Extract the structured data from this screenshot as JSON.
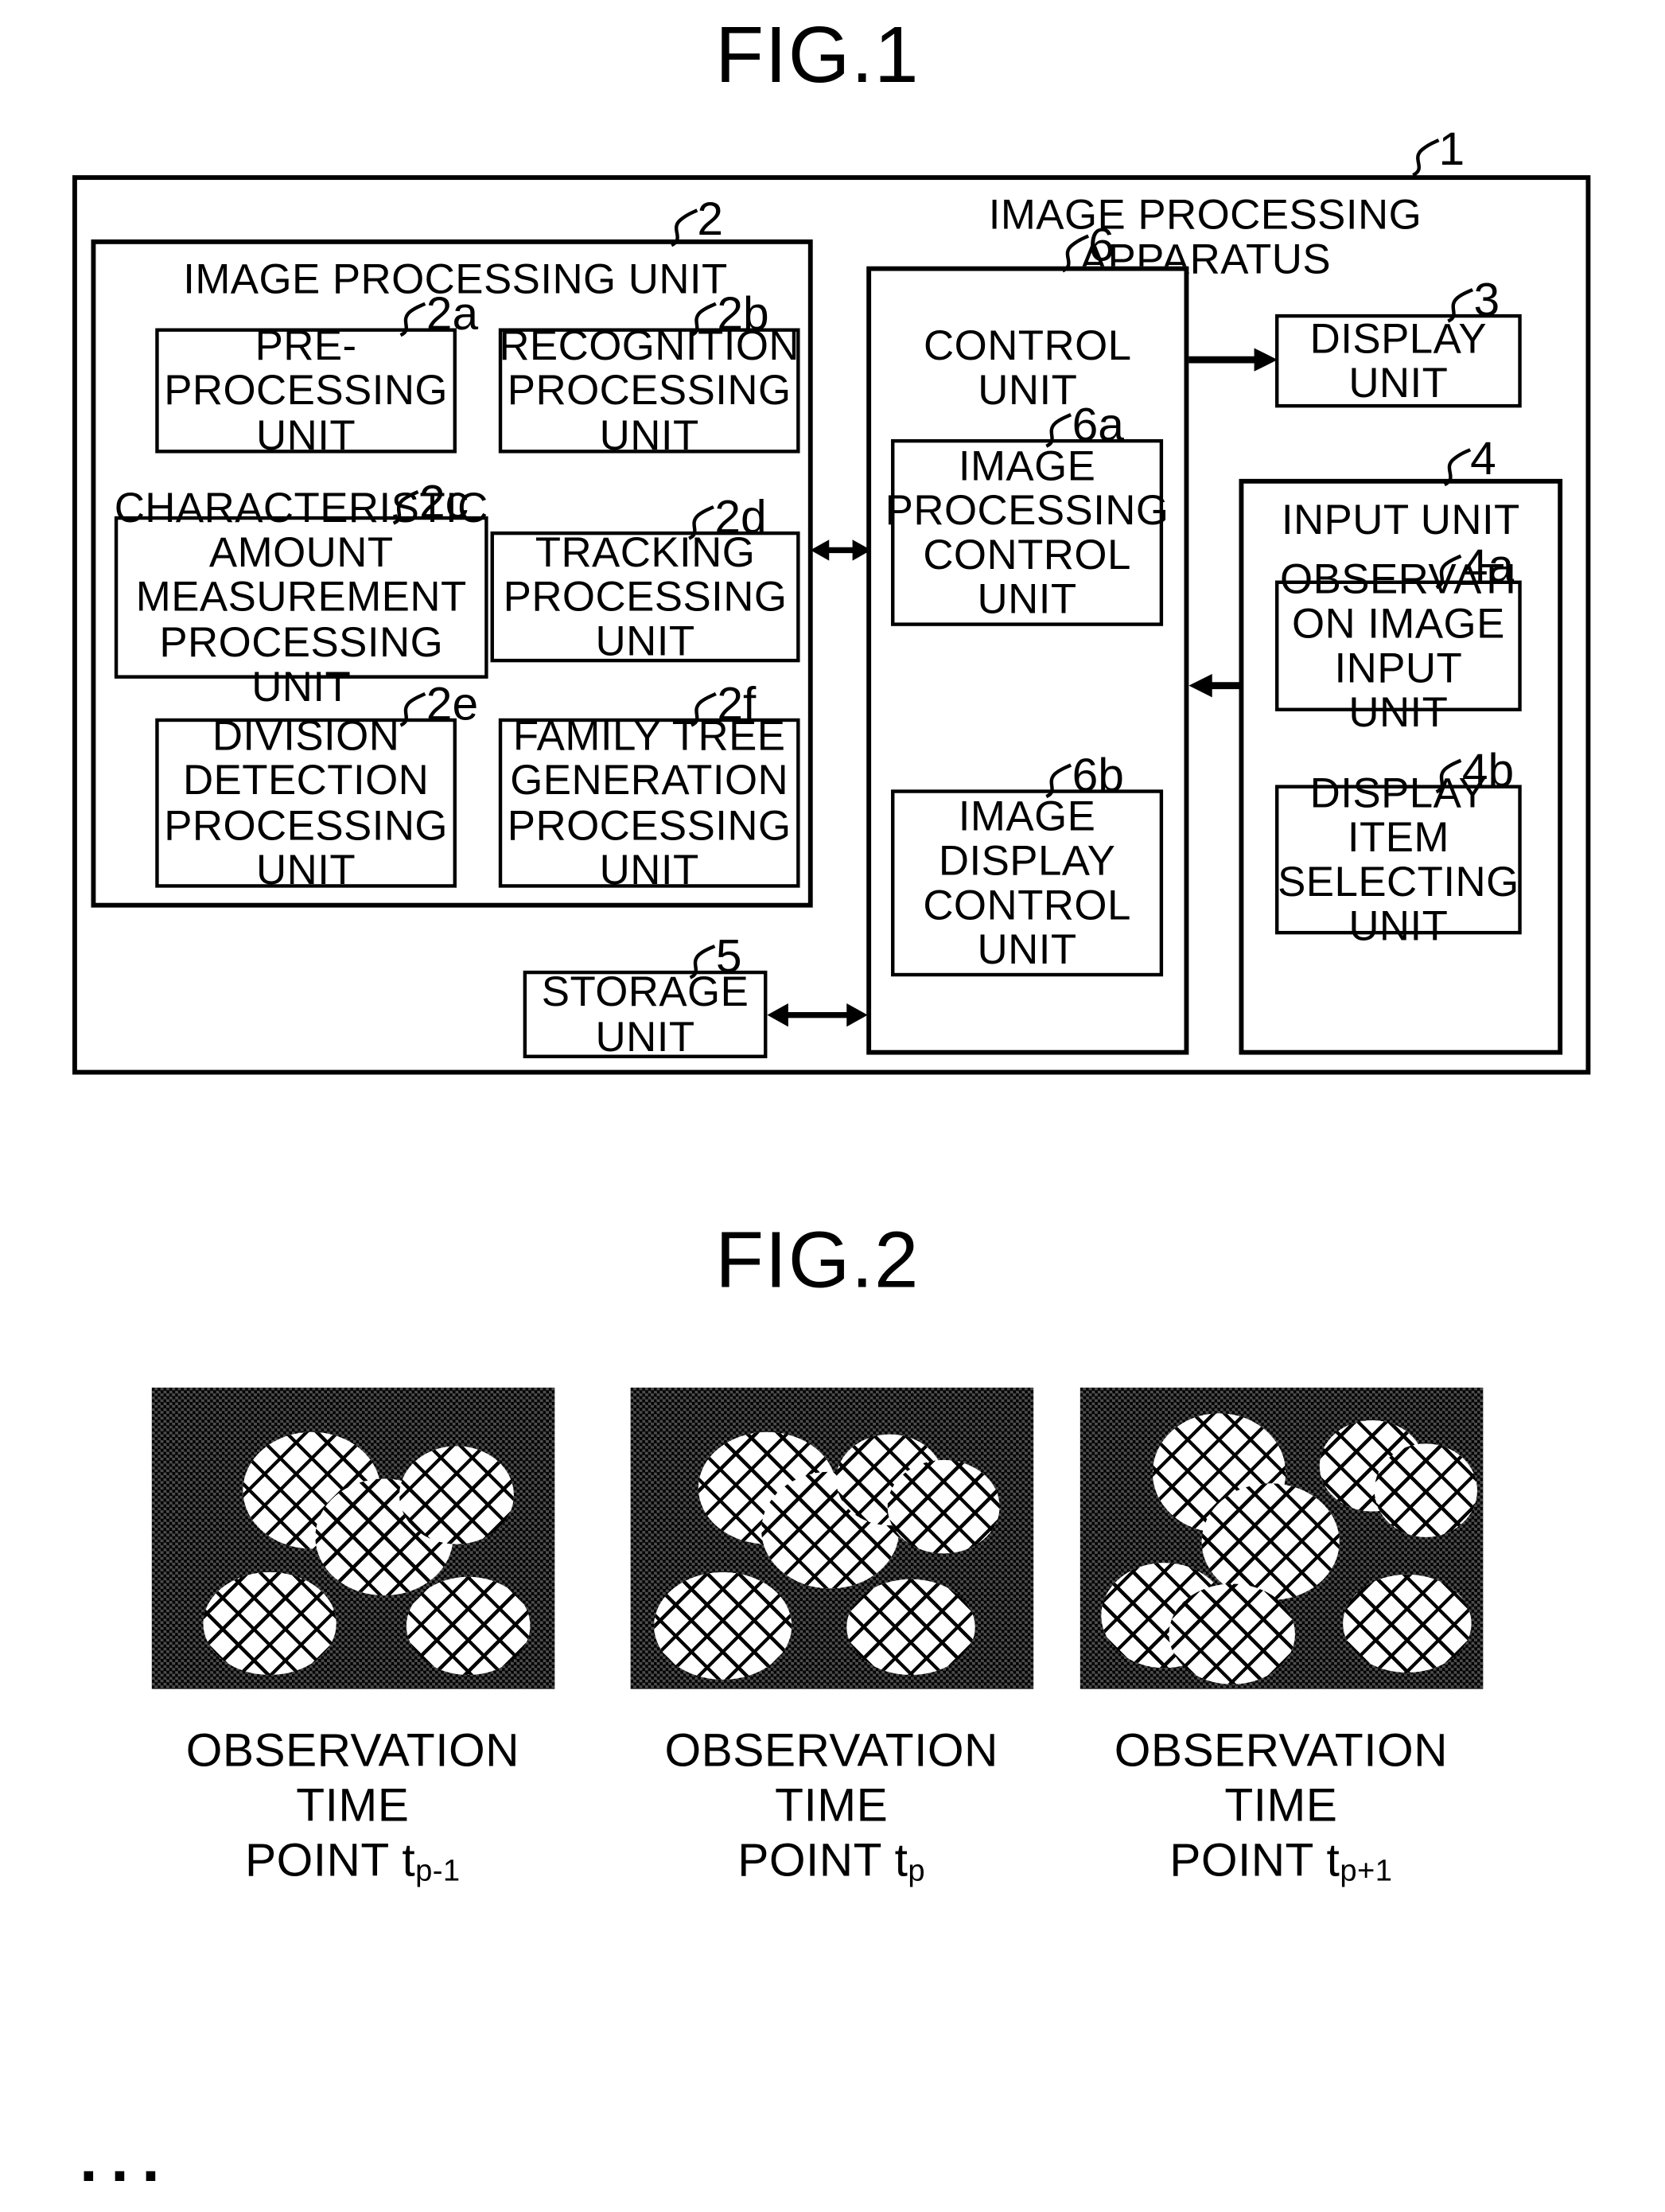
{
  "figures": [
    {
      "title": "FIG.1"
    },
    {
      "title": "FIG.2"
    }
  ],
  "fig1": {
    "title": "FIG.1",
    "apparatus": {
      "ref": "1",
      "title": "IMAGE PROCESSING APPARATUS"
    },
    "image_processing_unit": {
      "ref": "2",
      "title": "IMAGE PROCESSING UNIT",
      "blocks": [
        {
          "ref": "2a",
          "label": "PRE-\nPROCESSING\nUNIT"
        },
        {
          "ref": "2b",
          "label": "RECOGNITION\nPROCESSING\nUNIT"
        },
        {
          "ref": "2c",
          "label": "CHARACTERISTIC\nAMOUNT\nMEASUREMENT\nPROCESSING UNIT"
        },
        {
          "ref": "2d",
          "label": "TRACKING\nPROCESSING\nUNIT"
        },
        {
          "ref": "2e",
          "label": "DIVISION\nDETECTION\nPROCESSING\nUNIT"
        },
        {
          "ref": "2f",
          "label": "FAMILY TREE\nGENERATION\nPROCESSING\nUNIT"
        }
      ]
    },
    "control_unit": {
      "ref": "6",
      "title": "CONTROL UNIT",
      "blocks": [
        {
          "ref": "6a",
          "label": "IMAGE\nPROCESSING\nCONTROL\nUNIT"
        },
        {
          "ref": "6b",
          "label": "IMAGE\nDISPLAY\nCONTROL\nUNIT"
        }
      ]
    },
    "display_unit": {
      "ref": "3",
      "label": "DISPLAY\nUNIT"
    },
    "input_unit": {
      "ref": "4",
      "title": "INPUT UNIT",
      "blocks": [
        {
          "ref": "4a",
          "label": "OBSERVATI\nON IMAGE\nINPUT UNIT"
        },
        {
          "ref": "4b",
          "label": "DISPLAY\nITEM\nSELECTING\nUNIT"
        }
      ]
    },
    "storage_unit": {
      "ref": "5",
      "label": "STORAGE\nUNIT"
    }
  },
  "fig2": {
    "title": "FIG.2",
    "leading_ellipsis": "···",
    "trailing_ellipsis": "···",
    "panels": [
      {
        "caption_line1": "OBSERVATION TIME",
        "caption_line2": "POINT t",
        "caption_sub": "p-1"
      },
      {
        "caption_line1": "OBSERVATION TIME",
        "caption_line2": "POINT t",
        "caption_sub": "p"
      },
      {
        "caption_line1": "OBSERVATION TIME",
        "caption_line2": "POINT t",
        "caption_sub": "p+1"
      }
    ]
  },
  "colors": {
    "ink": "#000000",
    "paper": "#ffffff"
  }
}
